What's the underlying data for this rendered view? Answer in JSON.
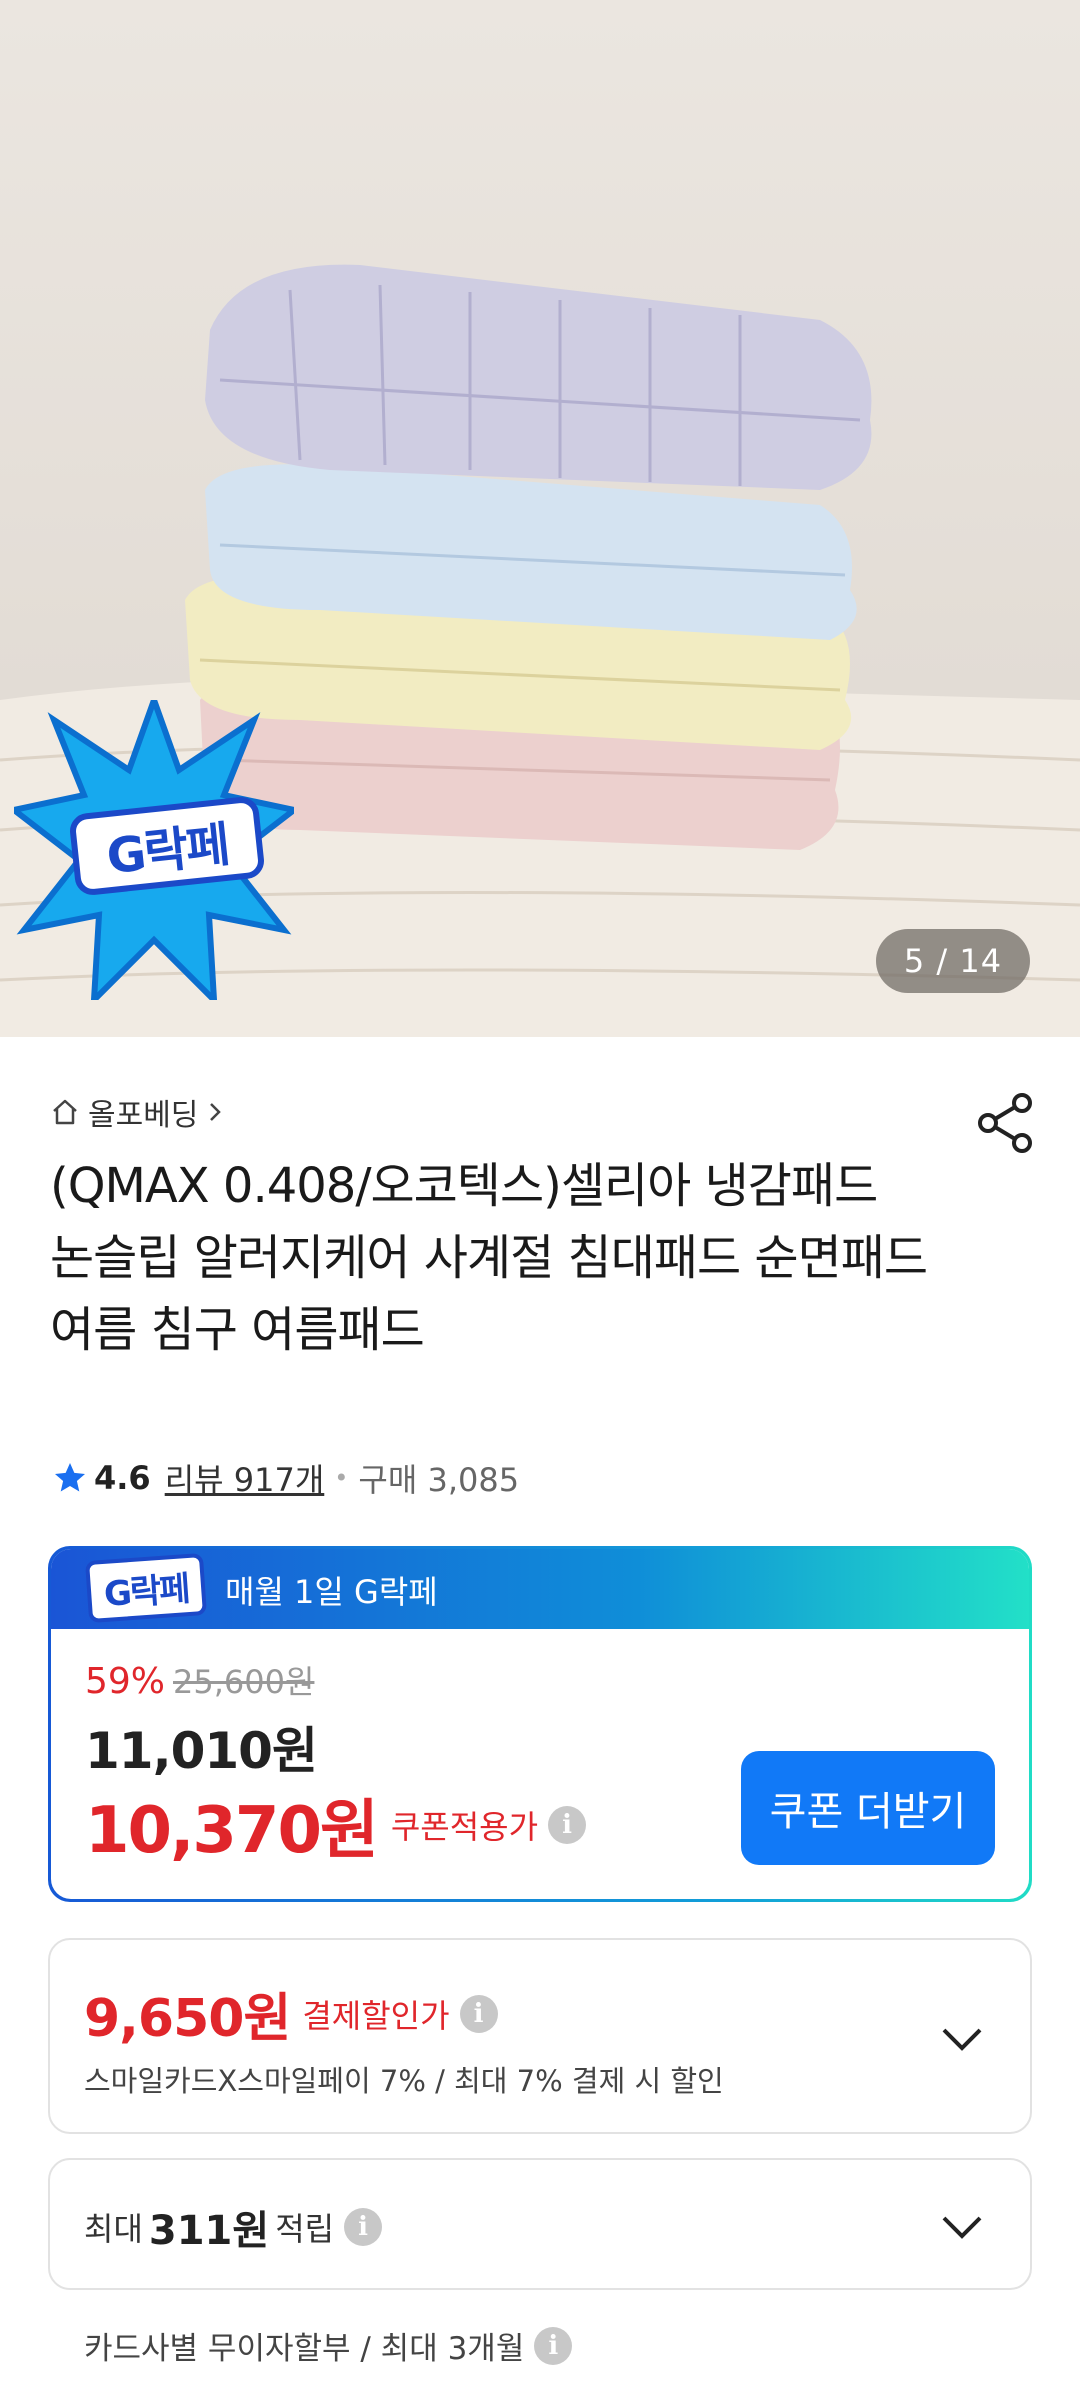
{
  "hero": {
    "counter": "5 / 14",
    "badge_text": "G락페"
  },
  "product": {
    "seller": "올포베딩",
    "title": "(QMAX 0.408/오코텍스)셀리아 냉감패드 논슬립 알러지케어 사계절 침대패드 순면패드 여름 침구 여름패드",
    "rating": "4.6",
    "review_label": "리뷰 917개",
    "purchase_label": "구매 3,085"
  },
  "gbox": {
    "logo_text": "G락페",
    "title": "매월 1일 G락페",
    "discount_pct": "59%",
    "original_price": "25,600원",
    "price": "11,010원",
    "coupon_price": "10,370원",
    "coupon_label": "쿠폰적용가",
    "coupon_button": "쿠폰 더받기"
  },
  "payment": {
    "price": "9,650원",
    "label": "결제할인가",
    "description": "스마일카드X스마일페이 7% / 최대 7% 결제 시 할인"
  },
  "points": {
    "prefix": "최대",
    "amount": "311원",
    "suffix": "적립"
  },
  "installment": "카드사별 무이자할부 / 최대 3개월",
  "colors": {
    "accent_blue": "#1179f7",
    "price_red": "#e0262b",
    "star_blue": "#1a6ff0"
  }
}
